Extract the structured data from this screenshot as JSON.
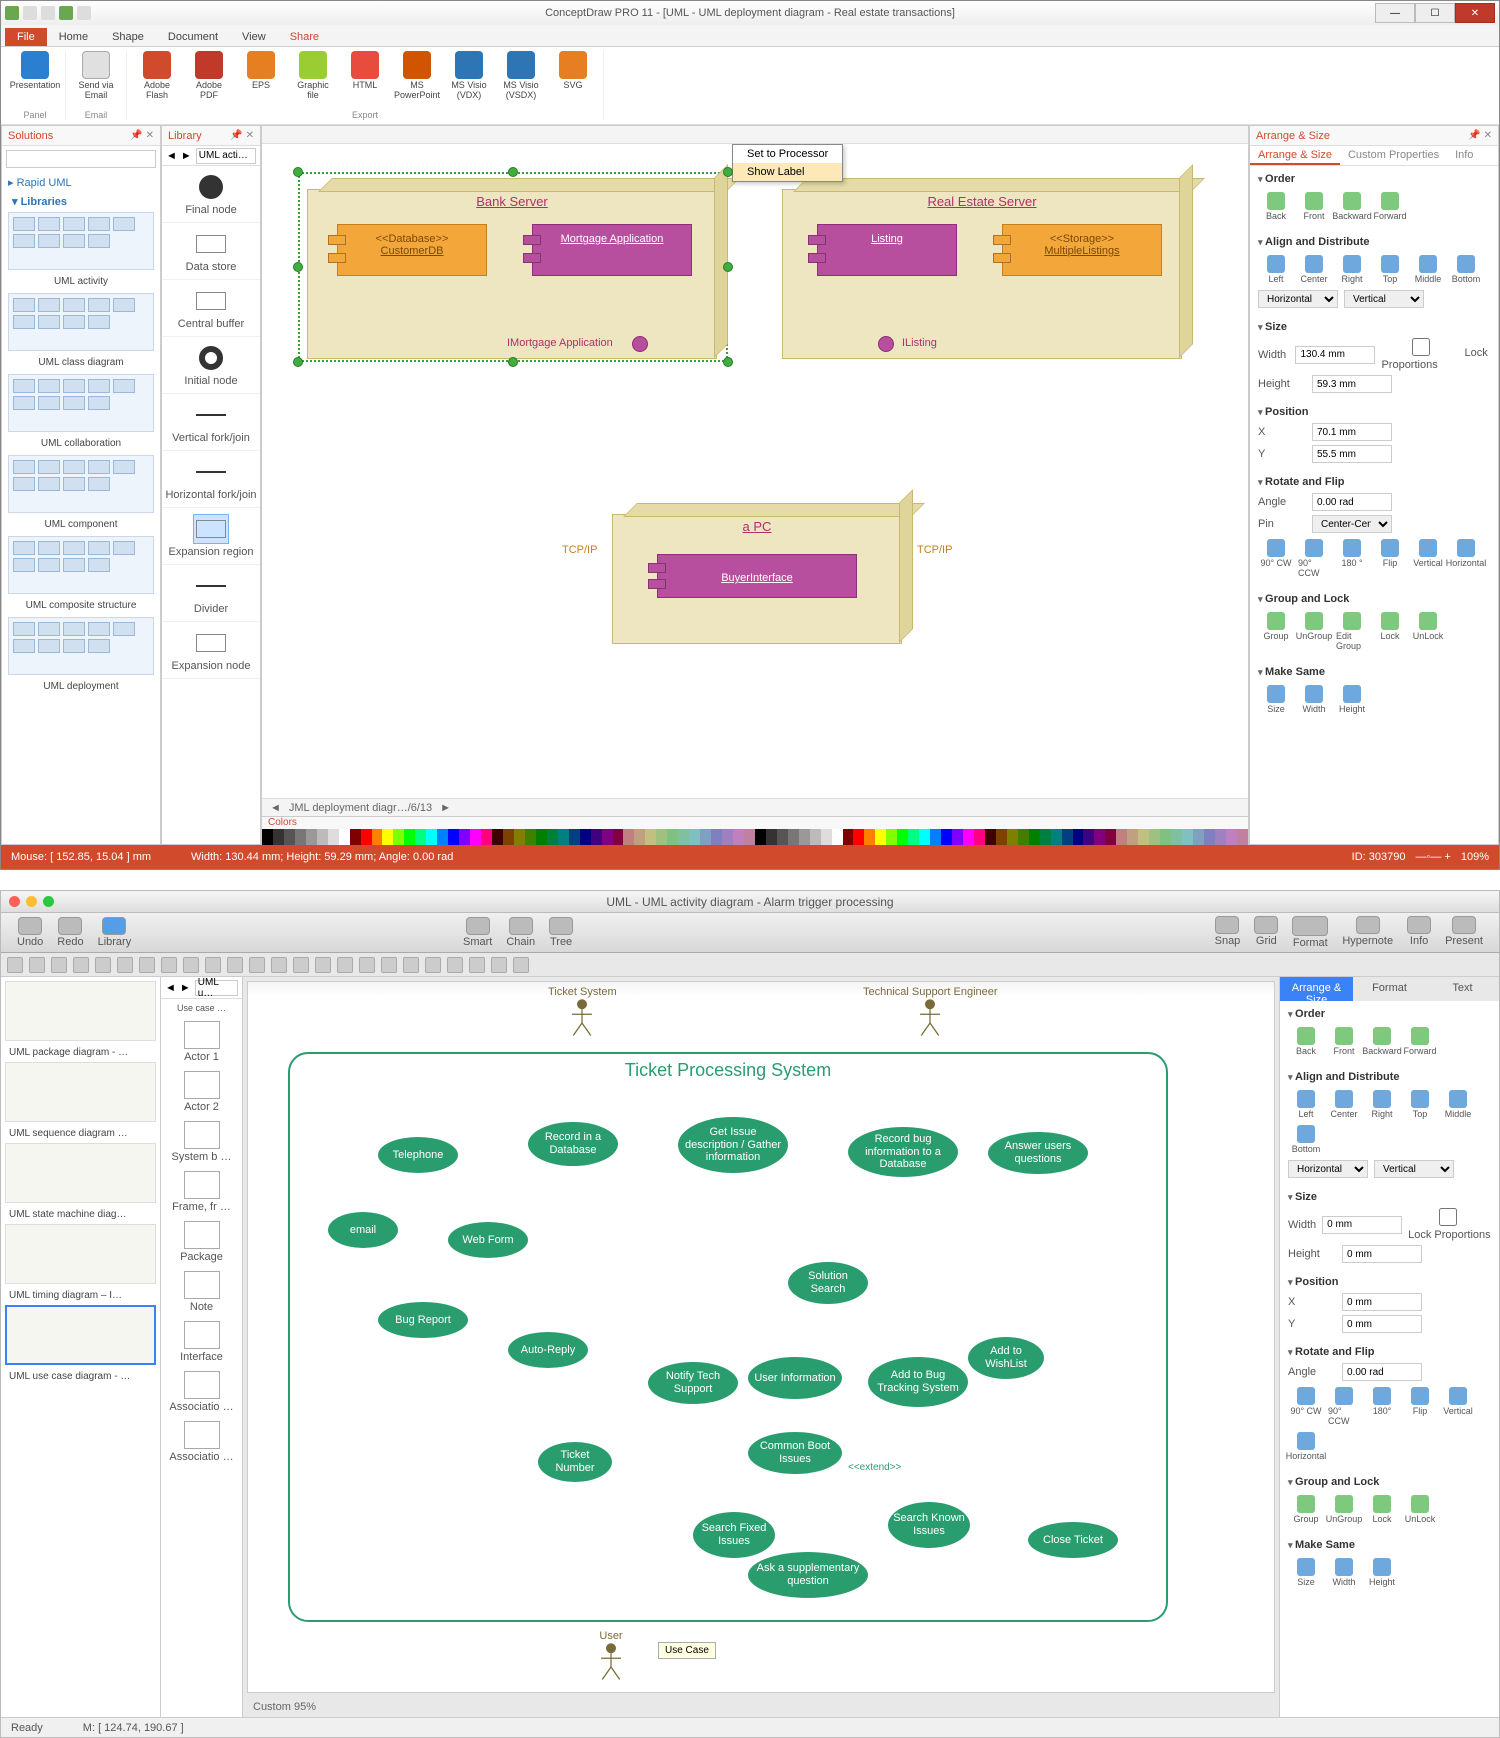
{
  "app1": {
    "title": "ConceptDraw PRO 11 - [UML - UML deployment diagram - Real estate transactions]",
    "ribbonTabs": [
      "File",
      "Home",
      "Shape",
      "Document",
      "View",
      "Share"
    ],
    "activeRibbonTab": "Share",
    "ribbon": {
      "groups": [
        {
          "label": "Panel",
          "buttons": [
            {
              "label": "Presentation",
              "ic": "ic-pres"
            }
          ]
        },
        {
          "label": "Email",
          "buttons": [
            {
              "label": "Send via Email",
              "ic": "ic-email"
            }
          ]
        },
        {
          "label": "Export",
          "buttons": [
            {
              "label": "Adobe Flash",
              "ic": "ic-flash"
            },
            {
              "label": "Adobe PDF",
              "ic": "ic-pdf"
            },
            {
              "label": "EPS",
              "ic": "ic-eps"
            },
            {
              "label": "Graphic file",
              "ic": "ic-gfile"
            },
            {
              "label": "HTML",
              "ic": "ic-html"
            },
            {
              "label": "MS PowerPoint",
              "ic": "ic-ppt"
            },
            {
              "label": "MS Visio (VDX)",
              "ic": "ic-vdx"
            },
            {
              "label": "MS Visio (VSDX)",
              "ic": "ic-vsdx"
            },
            {
              "label": "SVG",
              "ic": "ic-svg"
            }
          ]
        }
      ]
    },
    "solutions": {
      "title": "Solutions",
      "root": "Rapid UML",
      "sub": "Libraries",
      "items": [
        "UML activity",
        "UML class diagram",
        "UML collaboration",
        "UML component",
        "UML composite structure",
        "UML deployment"
      ]
    },
    "library": {
      "title": "Library",
      "selector": "UML acti…",
      "items": [
        {
          "label": "Final node",
          "shape": "circ-filled"
        },
        {
          "label": "Data store",
          "shape": "rect-o"
        },
        {
          "label": "Central buffer",
          "shape": "rect-o"
        },
        {
          "label": "Initial node",
          "shape": "circ-ring"
        },
        {
          "label": "Vertical fork/join",
          "shape": "line-h"
        },
        {
          "label": "Horizontal fork/join",
          "shape": "line-h"
        },
        {
          "label": "Expansion region",
          "shape": "rect-o",
          "sel": true
        },
        {
          "label": "Divider",
          "shape": "line-h"
        },
        {
          "label": "Expansion node",
          "shape": "rect-o"
        }
      ]
    },
    "contextMenu": [
      "Set to Processor",
      "Show Label"
    ],
    "canvas": {
      "tab": "JML deployment diagr…/6/13",
      "nodes": {
        "bank": {
          "title": "Bank Server"
        },
        "estate": {
          "title": "Real Estate Server"
        },
        "pc": {
          "title": "a PC"
        }
      },
      "components": {
        "customerDB": {
          "stereo": "<<Database>>",
          "name": "CustomerDB"
        },
        "mortgage": {
          "name": "Mortgage Application"
        },
        "listing": {
          "name": "Listing"
        },
        "storage": {
          "stereo": "<<Storage>>",
          "name": "MultipleListings"
        },
        "buyer": {
          "name": "BuyerInterface"
        }
      },
      "ports": {
        "imort": "IMortgage Application",
        "ilist": "IListing"
      },
      "links": {
        "tcp1": "TCP/IP",
        "tcp2": "TCP/IP"
      }
    },
    "colorsTitle": "Colors",
    "arrange": {
      "title": "Arrange & Size",
      "tabs": [
        "Arrange & Size",
        "Custom Properties",
        "Info"
      ],
      "order": {
        "hdr": "Order",
        "btns": [
          "Back",
          "Front",
          "Backward",
          "Forward"
        ]
      },
      "align": {
        "hdr": "Align and Distribute",
        "btns": [
          "Left",
          "Center",
          "Right",
          "Top",
          "Middle",
          "Bottom"
        ],
        "sel1": "Horizontal",
        "sel2": "Vertical"
      },
      "size": {
        "hdr": "Size",
        "w": "130.4 mm",
        "h": "59.3 mm",
        "lock": "Lock Proportions"
      },
      "position": {
        "hdr": "Position",
        "x": "70.1 mm",
        "y": "55.5 mm"
      },
      "rotate": {
        "hdr": "Rotate and Flip",
        "angle": "0.00 rad",
        "pin": "Center-Center",
        "btns": [
          "90° CW",
          "90° CCW",
          "180 °",
          "Flip",
          "Vertical",
          "Horizontal"
        ]
      },
      "group": {
        "hdr": "Group and Lock",
        "btns": [
          "Group",
          "UnGroup",
          "Edit Group",
          "Lock",
          "UnLock"
        ]
      },
      "same": {
        "hdr": "Make Same",
        "btns": [
          "Size",
          "Width",
          "Height"
        ]
      }
    },
    "status": {
      "mouse": "Mouse: [ 152.85, 15.04 ] mm",
      "dims": "Width: 130.44 mm;  Height: 59.29 mm;  Angle: 0.00 rad",
      "id": "ID: 303790",
      "zoom": "109%"
    }
  },
  "app2": {
    "title": "UML - UML activity diagram - Alarm trigger processing",
    "toolbar": {
      "left": [
        {
          "label": "Undo"
        },
        {
          "label": "Redo"
        },
        {
          "label": "Library",
          "active": true
        }
      ],
      "mid": [
        {
          "label": "Smart"
        },
        {
          "label": "Chain"
        },
        {
          "label": "Tree"
        }
      ],
      "right": [
        {
          "label": "Snap"
        },
        {
          "label": "Grid"
        },
        {
          "label": "Format",
          "big": true
        },
        {
          "label": "Hypernote"
        },
        {
          "label": "Info"
        },
        {
          "label": "Present"
        }
      ]
    },
    "libSel": "UML u…",
    "libCaption": "Use case …",
    "solutions": [
      "UML package diagram - …",
      "UML sequence diagram …",
      "UML state machine diag…",
      "UML timing diagram – I…",
      "UML use case diagram - …"
    ],
    "library": [
      {
        "label": "Actor 1"
      },
      {
        "label": "Actor 2"
      },
      {
        "label": "System b …"
      },
      {
        "label": "Frame, fr …"
      },
      {
        "label": "Package"
      },
      {
        "label": "Note"
      },
      {
        "label": "Interface"
      },
      {
        "label": "Associatio …"
      },
      {
        "label": "Associatio …"
      }
    ],
    "canvas": {
      "actors": {
        "ticket": "Ticket System",
        "eng": "Technical Support Engineer",
        "user": "User"
      },
      "systemTitle": "Ticket Processing System",
      "tooltip": "Use Case",
      "usecases": [
        "email",
        "Telephone",
        "Web Form",
        "Bug Report",
        "Auto-Reply",
        "Record in a Database",
        "Ticket Number",
        "Get Issue description / Gather information",
        "Notify Tech Support",
        "User Information",
        "Solution Search",
        "Common Boot Issues",
        "Search Fixed Issues",
        "Search Known Issues",
        "Ask a supplementary question",
        "Record bug information to a Database",
        "Add to Bug Tracking System",
        "Add to WishList",
        "Answer users questions",
        "Close Ticket"
      ],
      "extend": "<<extend>>",
      "zoom": "Custom 95%",
      "mouse": "M: [ 124.74, 190.67 ]"
    },
    "arrange": {
      "tabs": [
        "Arrange & Size",
        "Format",
        "Text"
      ],
      "order": {
        "hdr": "Order",
        "btns": [
          "Back",
          "Front",
          "Backward",
          "Forward"
        ]
      },
      "align": {
        "hdr": "Align and Distribute",
        "btns": [
          "Left",
          "Center",
          "Right",
          "Top",
          "Middle",
          "Bottom"
        ],
        "sel1": "Horizontal",
        "sel2": "Vertical"
      },
      "size": {
        "hdr": "Size",
        "w": "0 mm",
        "h": "0 mm",
        "lock": "Lock Proportions"
      },
      "position": {
        "hdr": "Position",
        "x": "0 mm",
        "y": "0 mm"
      },
      "rotate": {
        "hdr": "Rotate and Flip",
        "angle": "0.00 rad",
        "btns": [
          "90° CW",
          "90° CCW",
          "180°",
          "Flip",
          "Vertical",
          "Horizontal"
        ]
      },
      "group": {
        "hdr": "Group and Lock",
        "btns": [
          "Group",
          "UnGroup",
          "Lock",
          "UnLock"
        ]
      },
      "same": {
        "hdr": "Make Same",
        "btns": [
          "Size",
          "Width",
          "Height"
        ]
      }
    },
    "status": "Ready"
  }
}
